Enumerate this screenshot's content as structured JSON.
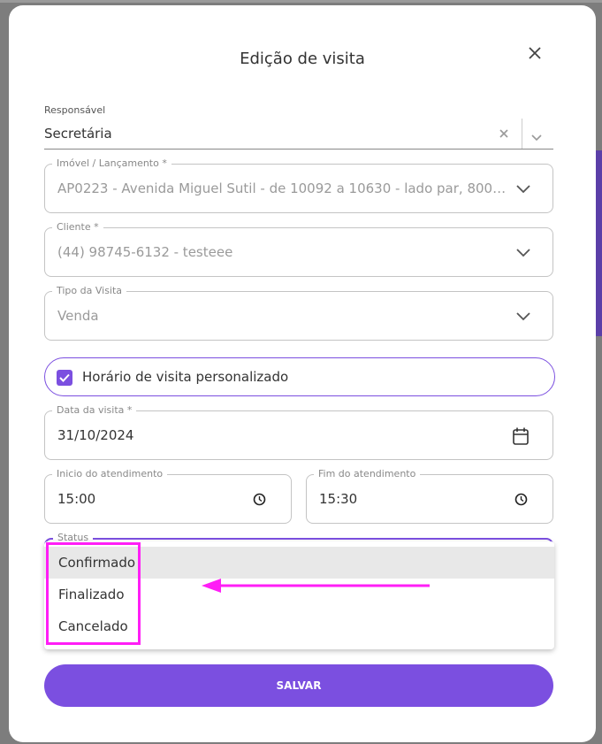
{
  "modal": {
    "title": "Edição de visita"
  },
  "responsavel": {
    "label": "Responsável",
    "value": "Secretária"
  },
  "imovel": {
    "label": "Imóvel / Lançamento *",
    "value": "AP0223 - Avenida Miguel Sutil - de 10092 a 10630 - lado par, 8000, A..."
  },
  "cliente": {
    "label": "Cliente *",
    "value": "(44) 98745-6132 - testeee"
  },
  "tipo": {
    "label": "Tipo da Visita",
    "value": "Venda"
  },
  "horario": {
    "label": "Horário de visita personalizado",
    "checked": true
  },
  "data_visita": {
    "label": "Data da visita *",
    "value": "31/10/2024"
  },
  "inicio": {
    "label": "Inicio do atendimento",
    "value": "15:00"
  },
  "fim": {
    "label": "Fim do atendimento",
    "value": "15:30"
  },
  "status": {
    "label": "Status",
    "options": [
      "Confirmado",
      "Finalizado",
      "Cancelado"
    ],
    "highlighted": "Confirmado"
  },
  "save_button": "SALVAR",
  "colors": {
    "accent": "#7b4fe0",
    "annotation": "#ff1ef6"
  },
  "icons": {
    "close": "close-icon",
    "clear": "clear-icon",
    "chevron": "chevron-down-icon",
    "calendar": "calendar-icon",
    "clock": "clock-icon",
    "check": "check-icon"
  }
}
